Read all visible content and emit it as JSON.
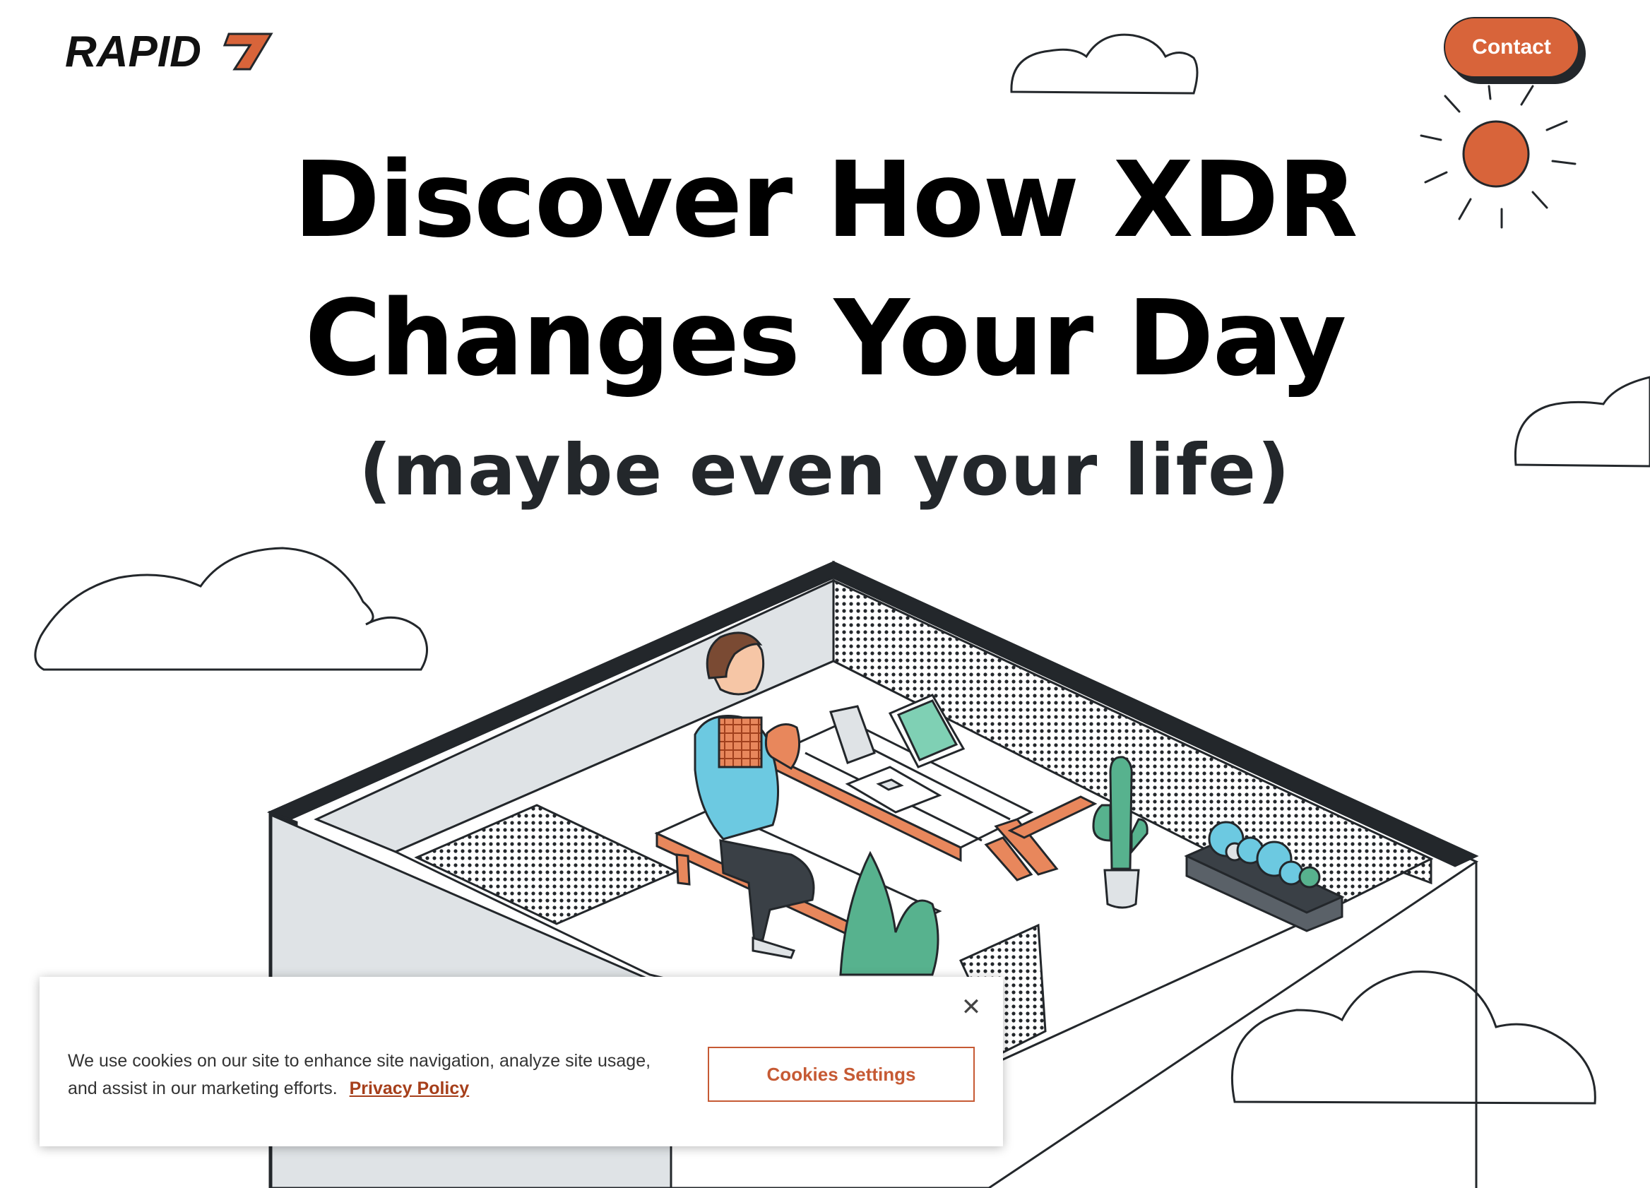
{
  "header": {
    "logo_text": "RAPID7",
    "contact_label": "Contact"
  },
  "hero": {
    "headline_line1": "Discover How XDR",
    "headline_line2": "Changes Your Day",
    "subheadline": "(maybe even your life)"
  },
  "cookie_banner": {
    "message": "We use cookies on our site to enhance site navigation, analyze site usage, and assist in our marketing efforts.",
    "privacy_link_label": "Privacy Policy",
    "settings_button_label": "Cookies Settings",
    "close_icon": "close-icon"
  },
  "colors": {
    "brand_orange": "#d8643a",
    "ink": "#23272b",
    "teal": "#57b28e",
    "sky_blue": "#6cc9e1",
    "wall_gray": "#dfe3e6"
  }
}
